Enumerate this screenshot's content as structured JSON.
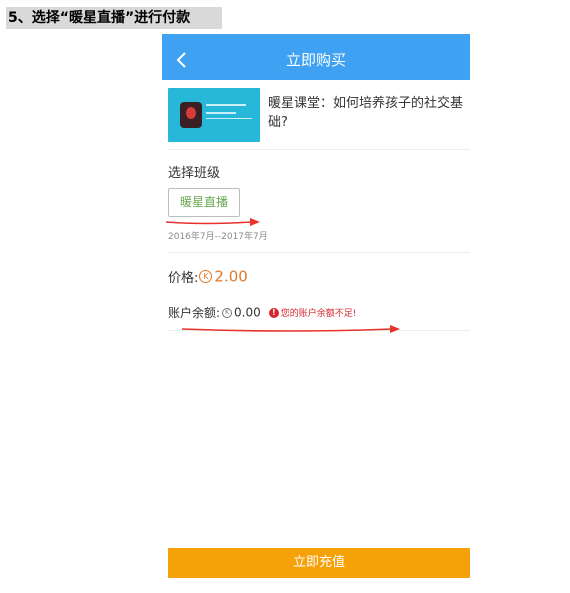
{
  "instruction": {
    "title": "5、选择“暖星直播”进行付款"
  },
  "navbar": {
    "title": "立即购买"
  },
  "course": {
    "title": "暖星课堂：如何培养孩子的社交基础?"
  },
  "class_section": {
    "label": "选择班级",
    "selected_option": "暖星直播",
    "date_range": "2016年7月--2017年7月"
  },
  "price": {
    "label": "价格:",
    "value": "2.00"
  },
  "balance": {
    "label": "账户余额:",
    "value": "0.00",
    "warning": "您的账户余额不足!"
  },
  "actions": {
    "recharge_label": "立即充值"
  },
  "colors": {
    "navbar_bg": "#3ea1f2",
    "price_accent": "#e07b2c",
    "warning_red": "#d6262d",
    "button_orange": "#f5a10a",
    "chip_text_green": "#6aa84f",
    "annotation_arrow_red": "#e8332b"
  }
}
